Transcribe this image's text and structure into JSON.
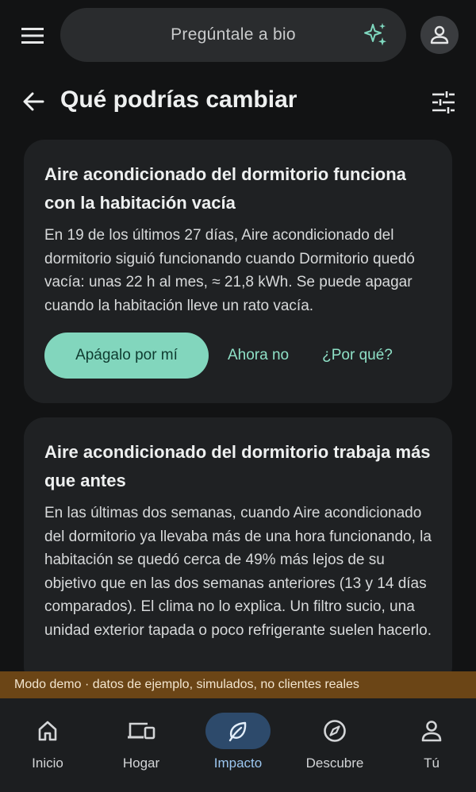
{
  "search": {
    "label": "Pregúntale a bio"
  },
  "header": {
    "title": "Qué podrías cambiar"
  },
  "cards": [
    {
      "title": "Aire acondicionado del dormitorio funciona con la habitación vacía",
      "body": "En 19 de los últimos 27 días, Aire acondicionado del dormitorio siguió funcionando cuando Dormitorio quedó vacía: unas 22 h al mes, ≈ 21,8 kWh. Se puede apagar cuando la habitación lleve un rato vacía.",
      "primary_action": "Apágalo por mí",
      "dismiss_action": "Ahora no",
      "why_action": "¿Por qué?"
    },
    {
      "title": "Aire acondicionado del dormitorio trabaja más que antes",
      "body": "En las últimas dos semanas, cuando Aire acondicionado del dormitorio ya llevaba más de una hora funcionando, la habitación se quedó cerca de 49% más lejos de su objetivo que en las dos semanas anteriores (13 y 14 días comparados). El clima no lo explica. Un filtro sucio, una unidad exterior tapada o poco refrigerante suelen hacerlo."
    }
  ],
  "banner": {
    "text": "Modo demo · datos de ejemplo, simulados, no clientes reales"
  },
  "nav": {
    "items": [
      {
        "label": "Inicio",
        "icon": "home-icon"
      },
      {
        "label": "Hogar",
        "icon": "devices-icon"
      },
      {
        "label": "Impacto",
        "icon": "leaf-icon",
        "active": true
      },
      {
        "label": "Descubre",
        "icon": "compass-icon"
      },
      {
        "label": "Tú",
        "icon": "person-icon"
      }
    ]
  },
  "colors": {
    "background": "#121314",
    "card": "#1f2123",
    "accent": "#82d6bd",
    "accent_text": "#8ee0c6",
    "nav_active": "#2d4a6b",
    "banner": "#6b4516"
  }
}
